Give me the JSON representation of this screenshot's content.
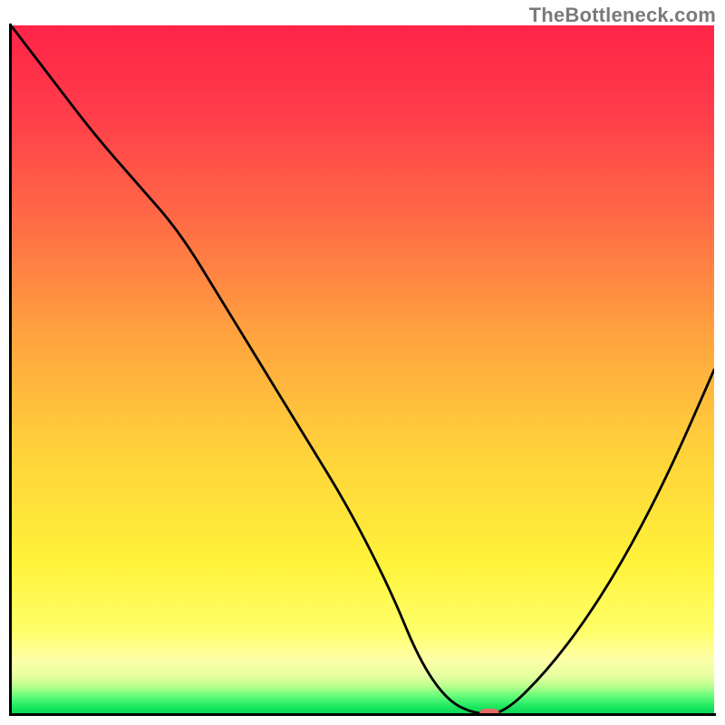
{
  "watermark": "TheBottleneck.com",
  "chart_data": {
    "type": "line",
    "title": "",
    "xlabel": "",
    "ylabel": "",
    "xlim": [
      0,
      100
    ],
    "ylim": [
      0,
      100
    ],
    "grid": false,
    "legend": false,
    "series": [
      {
        "name": "bottleneck-curve",
        "x": [
          0,
          6,
          12,
          18,
          24,
          30,
          36,
          42,
          48,
          54,
          58,
          62,
          66,
          70,
          76,
          82,
          88,
          94,
          100
        ],
        "y": [
          100,
          92,
          84,
          77,
          70,
          60,
          50,
          40,
          30,
          18,
          8,
          2,
          0,
          0,
          6,
          14,
          24,
          36,
          50
        ]
      }
    ],
    "marker": {
      "name": "optimal-point",
      "x": 68,
      "y": 0,
      "color": "#e46a6a"
    },
    "background_gradient_stops": [
      {
        "pos": 0.0,
        "color": "#ff2447"
      },
      {
        "pos": 0.28,
        "color": "#ff6a46"
      },
      {
        "pos": 0.62,
        "color": "#ffd23a"
      },
      {
        "pos": 0.88,
        "color": "#ffff6a"
      },
      {
        "pos": 0.96,
        "color": "#b6ff8c"
      },
      {
        "pos": 1.0,
        "color": "#0bd556"
      }
    ]
  }
}
